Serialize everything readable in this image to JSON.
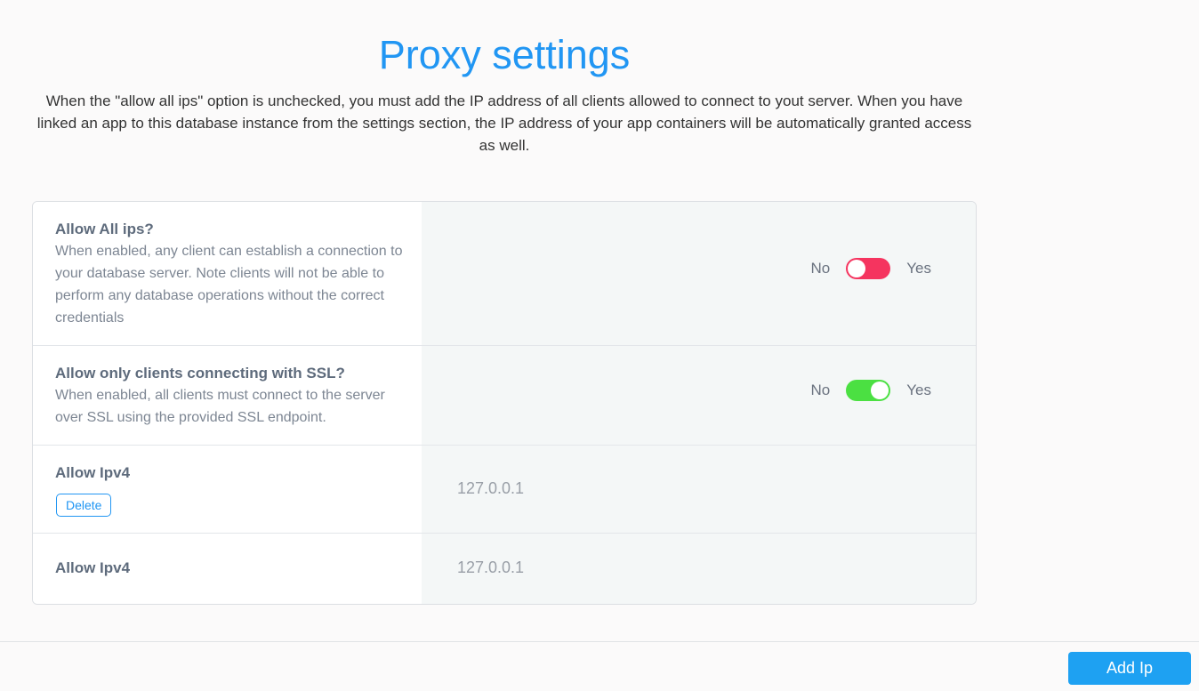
{
  "header": {
    "title": "Proxy settings",
    "intro": "When the \"allow all ips\" option is unchecked, you must add the IP address of all clients allowed to connect to yout server. When you have linked an app to this database instance from the settings section, the IP address of your app containers will be automatically granted access as well."
  },
  "settings": {
    "allow_all": {
      "title": "Allow All ips?",
      "description": "When enabled, any client can establish a connection to your database server. Note clients will not be able to perform any database operations without the correct credentials",
      "no_label": "No",
      "yes_label": "Yes",
      "enabled": false
    },
    "ssl_only": {
      "title": "Allow only clients connecting with SSL?",
      "description": "When enabled, all clients must connect to the server over SSL using the provided SSL endpoint.",
      "no_label": "No",
      "yes_label": "Yes",
      "enabled": true
    },
    "ips": [
      {
        "title": "Allow Ipv4",
        "value": "127.0.0.1",
        "delete_label": "Delete"
      },
      {
        "title": "Allow Ipv4",
        "value": "127.0.0.1"
      }
    ]
  },
  "footer": {
    "add_label": "Add Ip"
  },
  "colors": {
    "accent": "#2196f3",
    "toggle_off": "#f5345f",
    "toggle_on": "#4be042"
  }
}
